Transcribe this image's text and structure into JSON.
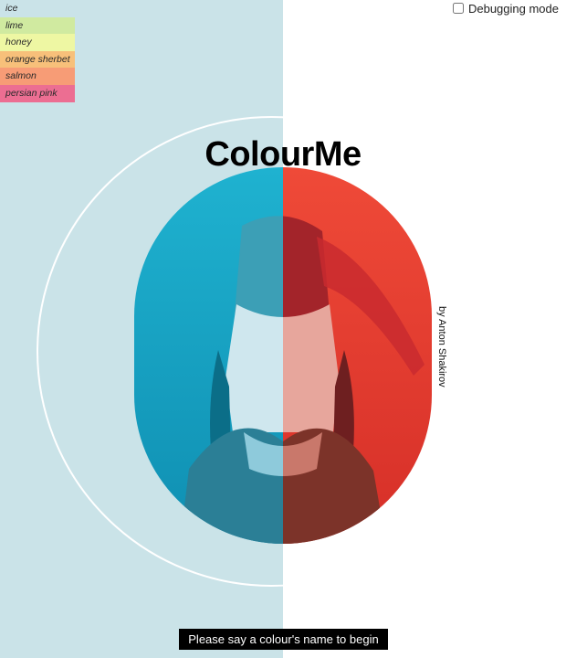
{
  "swatches": [
    {
      "label": "ice",
      "color": "#cae3e8"
    },
    {
      "label": "lime",
      "color": "#d0eaa0"
    },
    {
      "label": "honey",
      "color": "#eef7a3"
    },
    {
      "label": "orange sherbet",
      "color": "#f7c07a"
    },
    {
      "label": "salmon",
      "color": "#f79c76"
    },
    {
      "label": "persian pink",
      "color": "#ec6e92"
    }
  ],
  "debug_label": "Debugging mode",
  "title": "ColourMe",
  "byline": "by Anton Shakirov",
  "prompt": "Please say a colour's name to begin",
  "colors": {
    "left_background": "#cae3e8",
    "right_background": "#ffffff",
    "portrait_left": "#159fc0",
    "portrait_right": "#e33c2e"
  }
}
